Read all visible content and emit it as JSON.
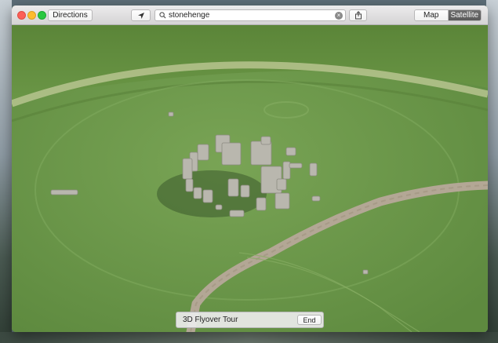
{
  "window": {
    "controls": [
      "close",
      "minimize",
      "zoom"
    ]
  },
  "toolbar": {
    "directions_label": "Directions",
    "location_icon": "location-arrow-icon",
    "search": {
      "value": "stonehenge",
      "icon": "search-icon",
      "clear_icon": "clear-icon"
    },
    "share_icon": "share-icon",
    "map_types": [
      {
        "label": "Map",
        "selected": false
      },
      {
        "label": "Satellite",
        "selected": true
      }
    ]
  },
  "flyover": {
    "label": "3D Flyover Tour",
    "end_label": "End"
  },
  "colors": {
    "grass": "#6f9a4e",
    "path": "#b3a795",
    "stone": "#b9b7ae",
    "selected_segment": "#5f5f5f"
  }
}
